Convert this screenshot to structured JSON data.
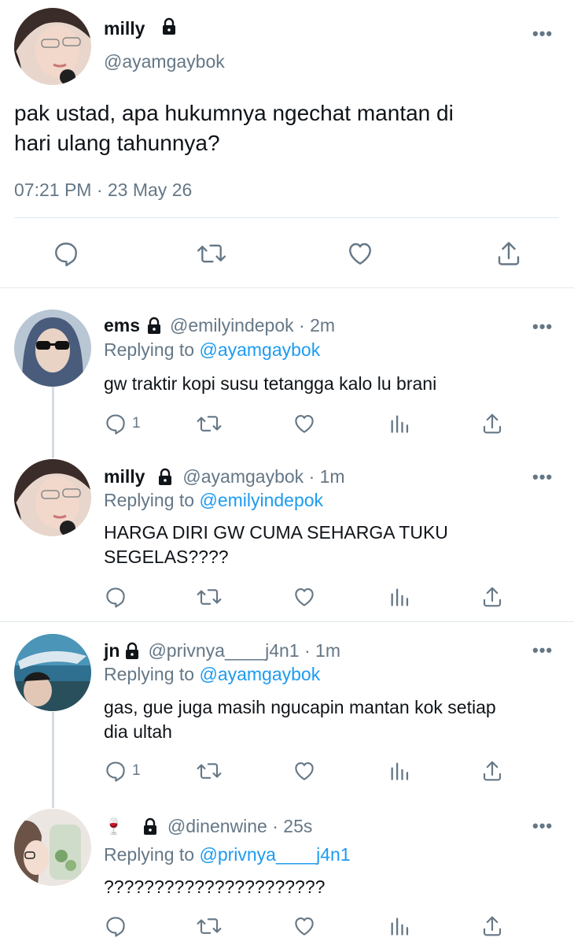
{
  "main_tweet": {
    "name": "milly",
    "handle": "@ayamgaybok",
    "text_line1": "pak ustad, apa hukumnya ngechat mantan di",
    "text_line2": "hari ulang tahunnya?",
    "timestamp": "07:21 PM · 23 May 26",
    "more": "•••"
  },
  "replies": [
    {
      "name": "ems",
      "handle": "@emilyindepok · 2m",
      "replying_prefix": "Replying to",
      "replying_to": "@ayamgaybok",
      "text_line1": "gw traktir kopi susu tetangga kalo lu brani",
      "text_line2": "",
      "reply_count": "1",
      "more": "•••"
    },
    {
      "name": "milly",
      "handle": "@ayamgaybok · 1m",
      "replying_prefix": "Replying to",
      "replying_to": "@emilyindepok",
      "text_line1": "HARGA DIRI GW CUMA SEHARGA TUKU",
      "text_line2": "SEGELAS????",
      "reply_count": "",
      "more": "•••"
    },
    {
      "name": "jn",
      "handle": "@privnya____j4n1 · 1m",
      "replying_prefix": "Replying to",
      "replying_to": "@ayamgaybok",
      "text_line1": "gas, gue juga masih ngucapin mantan kok setiap",
      "text_line2": "dia ultah",
      "reply_count": "1",
      "more": "•••"
    },
    {
      "name": "🍷",
      "handle": "@dinenwine · 25s",
      "replying_prefix": "Replying to",
      "replying_to": "@privnya____j4n1",
      "text_line1": "??????????????????????",
      "text_line2": "",
      "reply_count": "",
      "more": "•••"
    }
  ],
  "colors": {
    "link": "#1d9bf0",
    "muted": "#657786",
    "divider": "#e1e8ed"
  }
}
